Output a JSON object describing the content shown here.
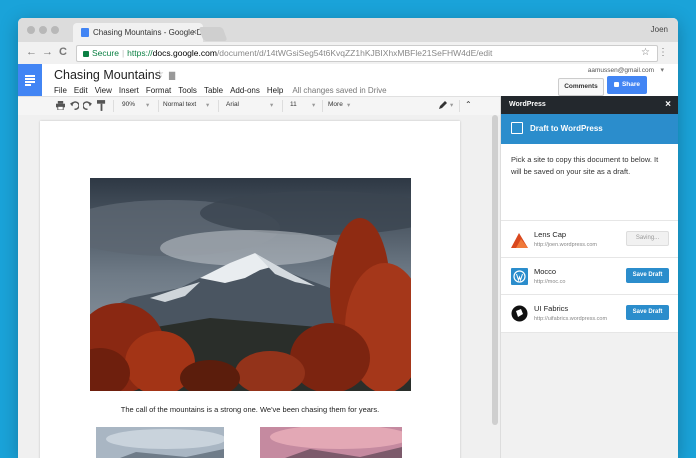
{
  "browser": {
    "tab_title": "Chasing Mountains - Google D",
    "tab_close": "×",
    "user": "Joen",
    "secure_label": "Secure",
    "url_scheme": "https://",
    "url_host": "docs.google.com",
    "url_path": "/document/d/14tWGsiSeg54t6KvqZZ1hKJBIXhxMBFle21SeFHW4dE/edit",
    "back": "←",
    "forward": "→",
    "reload": "C",
    "star": "☆",
    "menu": "⋮"
  },
  "docs": {
    "title": "Chasing Mountains",
    "star": "☆",
    "folder": "▇",
    "menus": [
      "File",
      "Edit",
      "View",
      "Insert",
      "Format",
      "Tools",
      "Table",
      "Add-ons",
      "Help"
    ],
    "saved_status": "All changes saved in Drive",
    "account_email": "aamussen@gmail.com",
    "comments_label": "Comments",
    "share_label": "Share"
  },
  "toolbar": {
    "zoom": "90%",
    "style": "Normal text",
    "font": "Arial",
    "size": "11",
    "more": "More",
    "caret": "▾",
    "collapse": "⌃"
  },
  "document": {
    "caption": "The call of the mountains is a strong one. We've been chasing them for years."
  },
  "sidebar": {
    "header": "WordPress",
    "close": "×",
    "draft_title": "Draft to WordPress",
    "description": "Pick a site to copy this document to below. It will be saved on your site as a draft.",
    "sites": [
      {
        "name": "Lens Cap",
        "url": "http://joen.wordpress.com",
        "button": "Saving..."
      },
      {
        "name": "Mocco",
        "url": "http://moc.co",
        "button": "Save Draft"
      },
      {
        "name": "UI Fabrics",
        "url": "http://uifabrics.wordpress.com",
        "button": "Save Draft"
      }
    ]
  },
  "colors": {
    "background": "#1aa3d9",
    "docs_blue": "#4285f4",
    "wp_dark": "#23282d",
    "wp_blue": "#2b8dcc"
  }
}
